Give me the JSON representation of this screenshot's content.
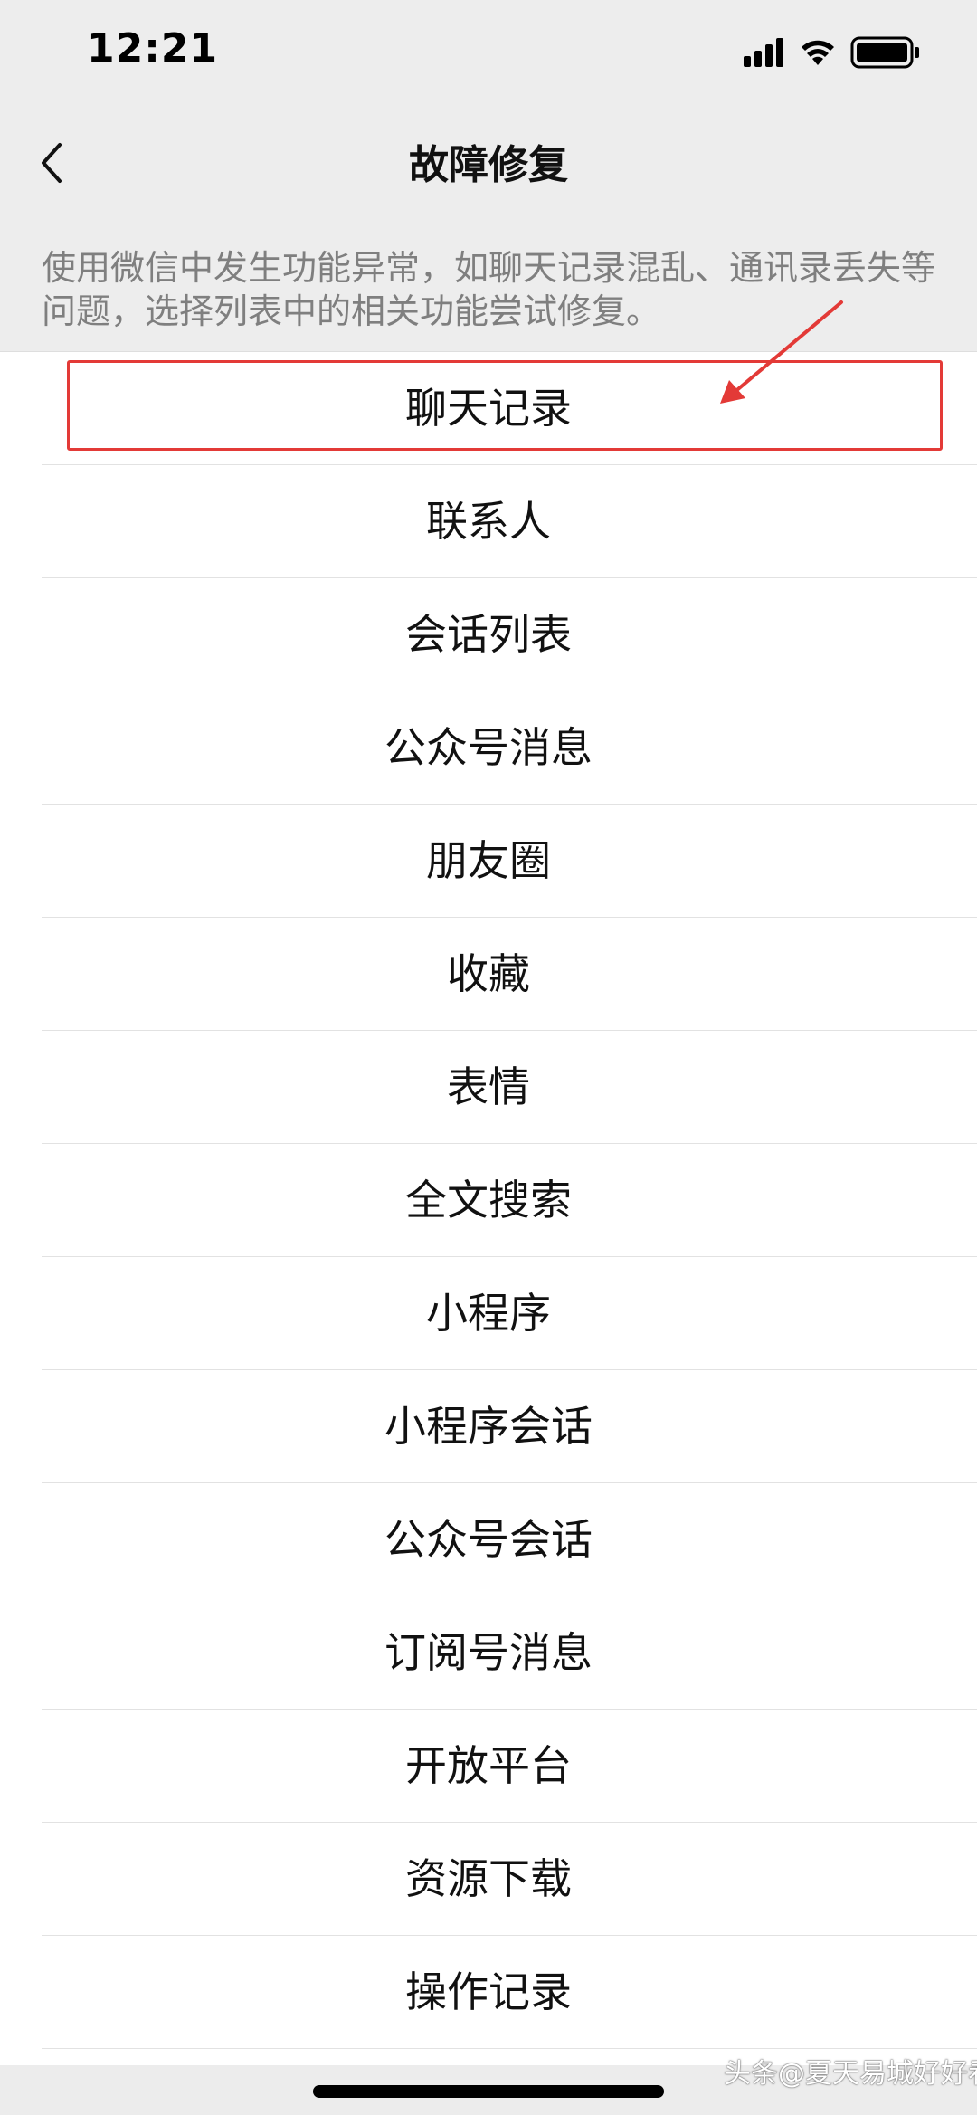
{
  "status_bar": {
    "time": "12:21",
    "icons": [
      "cellular-signal-icon",
      "wifi-icon",
      "battery-icon"
    ]
  },
  "nav": {
    "title": "故障修复",
    "back_icon": "chevron-left-icon"
  },
  "description": "使用微信中发生功能异常，如聊天记录混乱、通讯录丢失等问题，选择列表中的相关功能尝试修复。",
  "list": {
    "items": [
      "聊天记录",
      "联系人",
      "会话列表",
      "公众号消息",
      "朋友圈",
      "收藏",
      "表情",
      "全文搜索",
      "小程序",
      "小程序会话",
      "公众号会话",
      "订阅号消息",
      "开放平台",
      "资源下载",
      "操作记录"
    ]
  },
  "annotation": {
    "color": "#e33a37",
    "highlighted_item": "聊天记录"
  },
  "watermark": "头条@夏天易城好好看"
}
